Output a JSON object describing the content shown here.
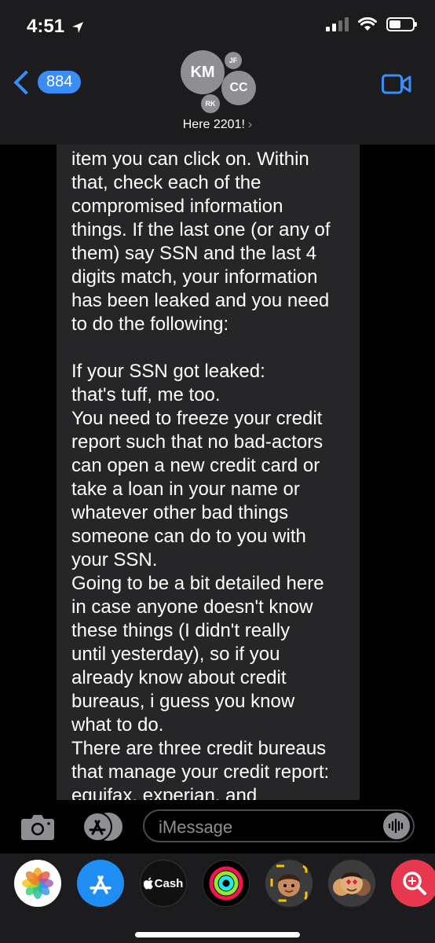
{
  "status_bar": {
    "time": "4:51"
  },
  "header": {
    "back_count": "884",
    "avatars": [
      "KM",
      "CC",
      "JF",
      "RK"
    ],
    "chat_name": "Here 2201!",
    "chevron": "›"
  },
  "message": {
    "lines": [
      "item you can click on. Within",
      "that, check each of the",
      "compromised information",
      "things. If the last one (or any of",
      "them) say SSN and the last 4",
      "digits match, your information",
      "has been leaked and you need",
      "to do the following:",
      "",
      "If your SSN got leaked:",
      "that's tuff, me too.",
      "You need to freeze your credit",
      "report such that no bad-actors",
      "can open a new credit card or",
      "take a loan in your name or",
      "whatever other bad things",
      "someone can do to you with",
      "your SSN.",
      "Going to be a bit detailed here",
      "in case anyone doesn't know",
      "these things (I didn't really",
      "until yesterday), so if you",
      "already know about credit",
      "bureaus, i guess you know",
      "what to do.",
      "There are three credit bureaus",
      "that manage your credit report:",
      "equifax, experian, and"
    ]
  },
  "input": {
    "placeholder": "iMessage"
  },
  "app_drawer": {
    "apps": [
      "photos-icon",
      "app-store-icon",
      "apple-cash-icon",
      "activity-icon",
      "memoji-icon",
      "animoji-icon",
      "images-search-icon"
    ],
    "cash_label": "Cash"
  },
  "colors": {
    "accent": "#3a8cf7",
    "bubble": "#262628",
    "header": "#1c1c1e"
  }
}
